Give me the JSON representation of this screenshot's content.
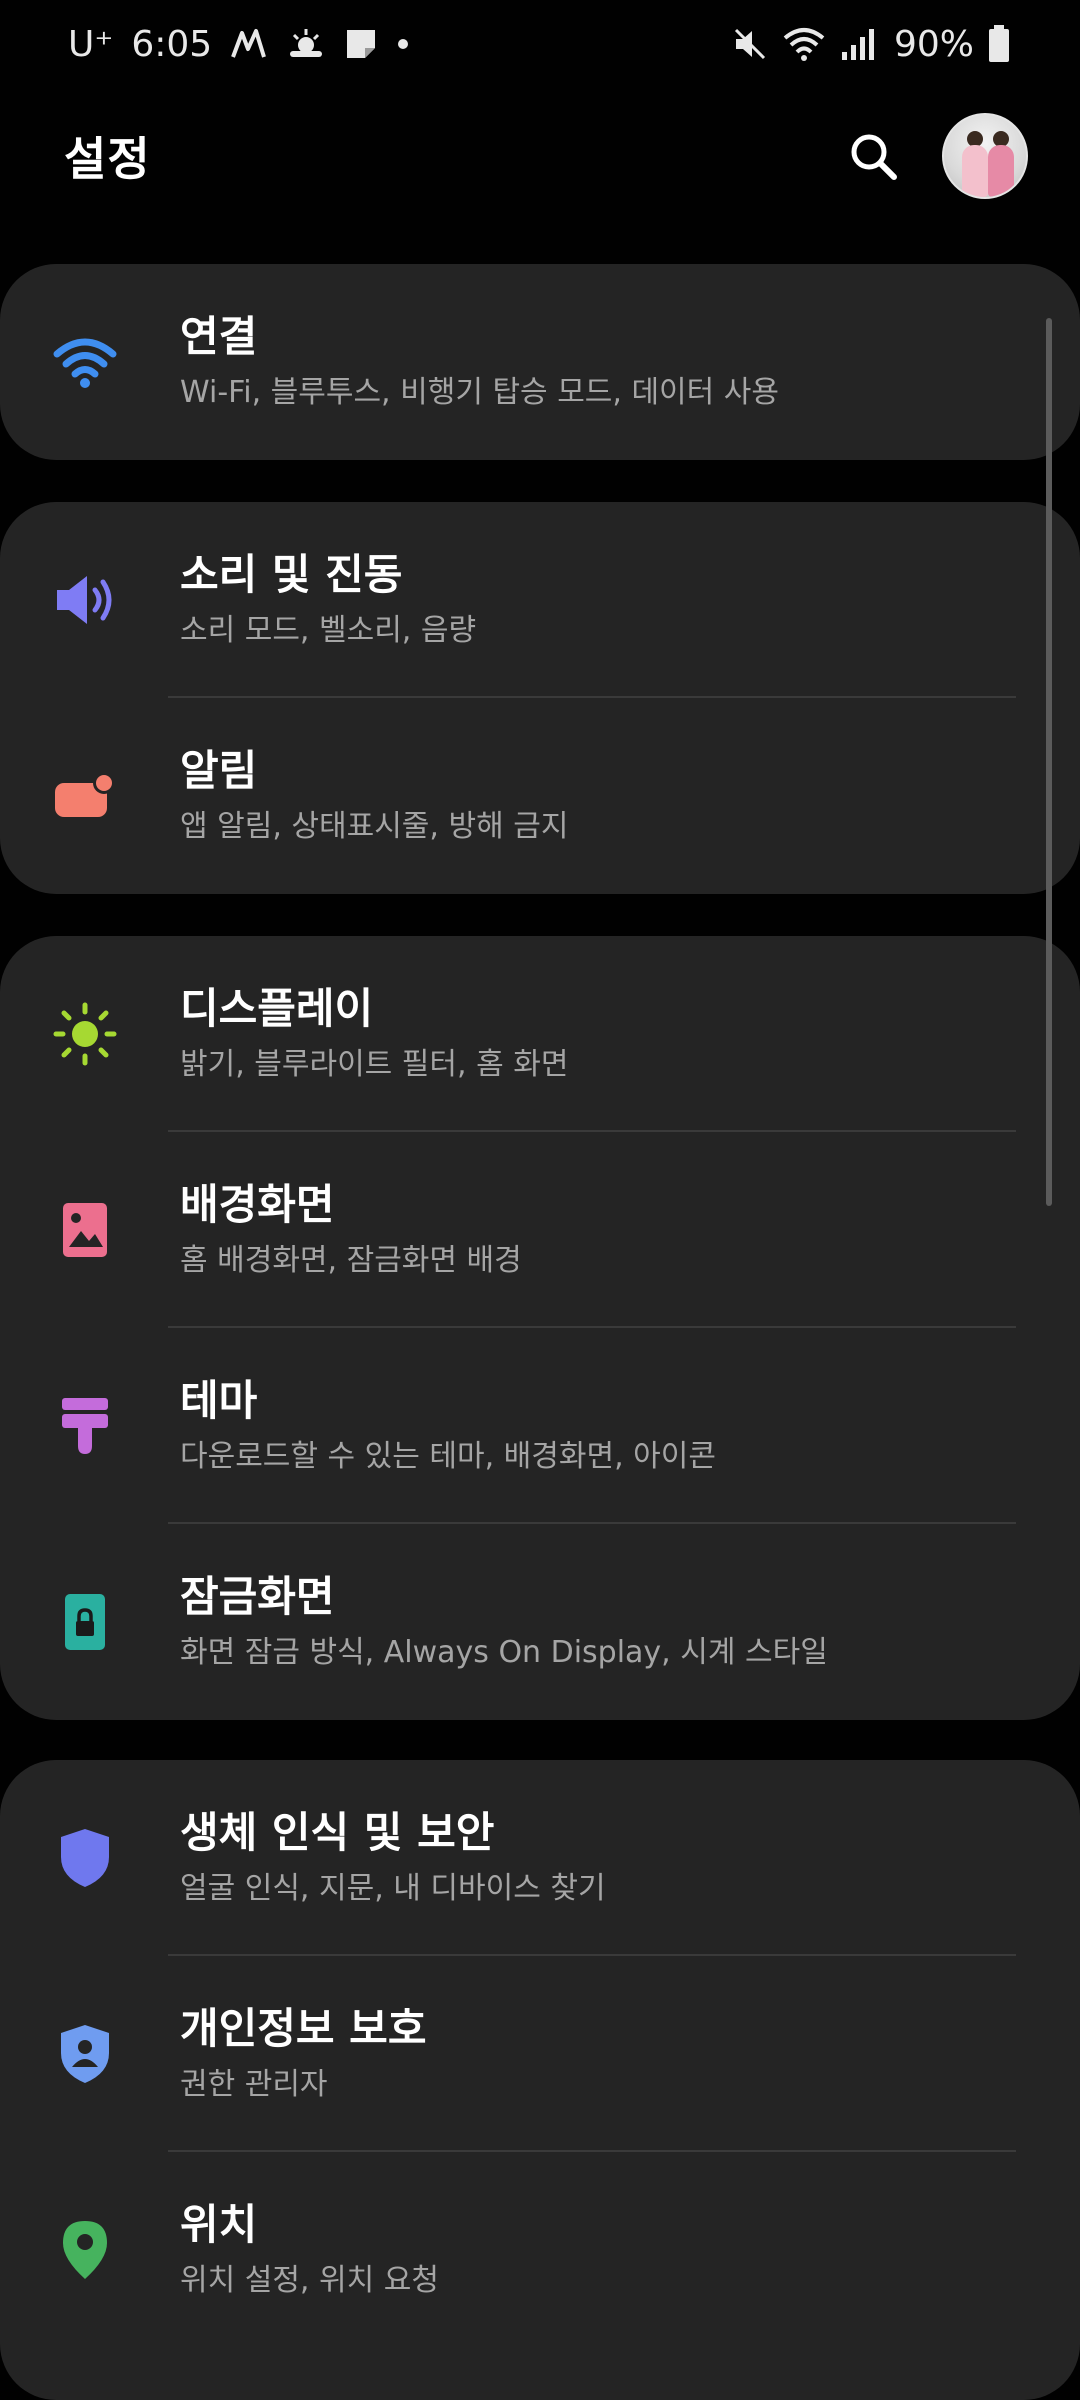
{
  "status_bar": {
    "carrier": "U⁺",
    "time": "6:05",
    "battery": "90%"
  },
  "header": {
    "title": "설정"
  },
  "colors": {
    "background": "#010101",
    "card": "#242424",
    "wifi": "#3f8ef0",
    "sound": "#7f7cf4",
    "notification": "#f47f6e",
    "display": "#a6d932",
    "wallpaper": "#ec6f8e",
    "theme": "#c46cdb",
    "lockscreen": "#2ab0a0",
    "biometrics": "#6f78ee",
    "privacy": "#6f9cf0",
    "location": "#46b35e"
  },
  "settings": {
    "connections": {
      "title": "연결",
      "subtitle": "Wi-Fi, 블루투스, 비행기 탑승 모드, 데이터 사용",
      "icon": "wifi-icon"
    },
    "sound": {
      "title": "소리 및 진동",
      "subtitle": "소리 모드, 벨소리, 음량",
      "icon": "speaker-icon"
    },
    "notifications": {
      "title": "알림",
      "subtitle": "앱 알림, 상태표시줄, 방해 금지",
      "icon": "notification-icon"
    },
    "display": {
      "title": "디스플레이",
      "subtitle": "밝기, 블루라이트 필터, 홈 화면",
      "icon": "sun-icon"
    },
    "wallpaper": {
      "title": "배경화면",
      "subtitle": "홈 배경화면, 잠금화면 배경",
      "icon": "image-icon"
    },
    "themes": {
      "title": "테마",
      "subtitle": "다운로드할 수 있는 테마, 배경화면, 아이콘",
      "icon": "paintbrush-icon"
    },
    "lockscreen": {
      "title": "잠금화면",
      "subtitle": "화면 잠금 방식, Always On Display, 시계 스타일",
      "icon": "lock-icon"
    },
    "biometrics": {
      "title": "생체 인식 및 보안",
      "subtitle": "얼굴 인식, 지문, 내 디바이스 찾기",
      "icon": "shield-icon"
    },
    "privacy": {
      "title": "개인정보 보호",
      "subtitle": "권한 관리자",
      "icon": "privacy-shield-icon"
    },
    "location": {
      "title": "위치",
      "subtitle": "위치 설정, 위치 요청",
      "icon": "location-pin-icon"
    }
  }
}
